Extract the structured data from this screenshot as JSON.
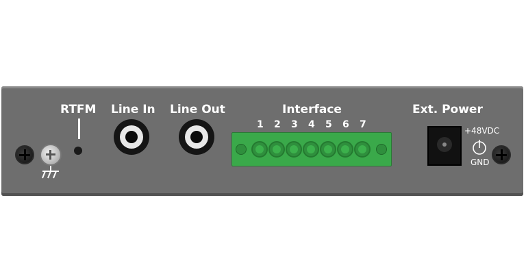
{
  "labels": {
    "rtfm": "RTFM",
    "line_in": "Line In",
    "line_out": "Line Out",
    "interface": "Interface",
    "ext_power": "Ext. Power",
    "voltage": "+48VDC",
    "gnd": "GND"
  },
  "terminal_numbers": [
    "1",
    "2",
    "3",
    "4",
    "5",
    "6",
    "7"
  ],
  "icons": [
    "screw-icon",
    "ground-symbol-icon",
    "power-symbol-icon"
  ],
  "colors": {
    "panel": "#6e6e6e",
    "terminal": "#3aa94a",
    "text": "#ffffff"
  }
}
